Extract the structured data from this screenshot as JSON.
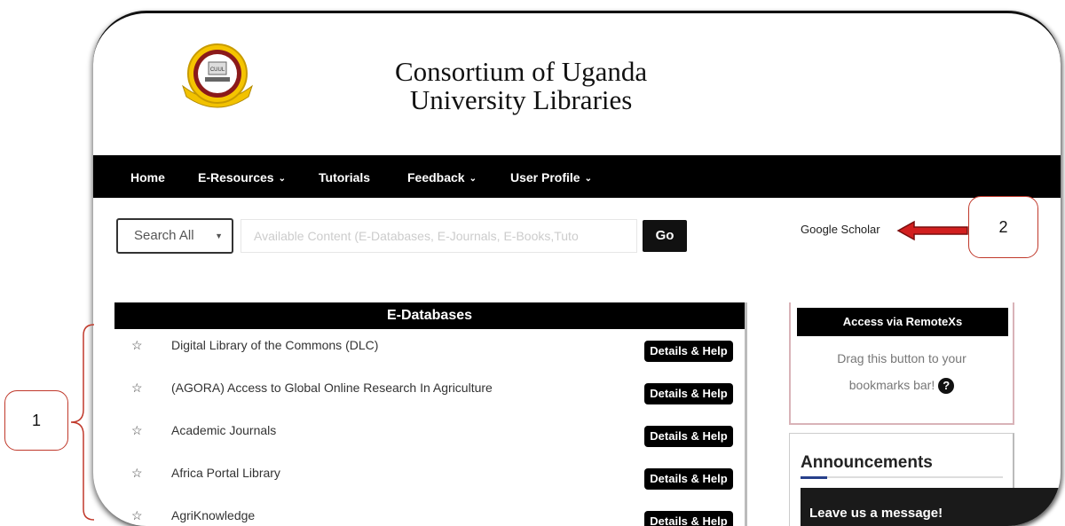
{
  "site": {
    "title_line1": "Consortium of Uganda",
    "title_line2": "University Libraries"
  },
  "nav": {
    "items": [
      {
        "label": "Home",
        "dropdown": false
      },
      {
        "label": "E-Resources",
        "dropdown": true
      },
      {
        "label": "Tutorials",
        "dropdown": false
      },
      {
        "label": "Feedback",
        "dropdown": true
      },
      {
        "label": "User Profile",
        "dropdown": true
      }
    ]
  },
  "search": {
    "scope_value": "Search All",
    "placeholder": "Available Content (E-Databases, E-Journals, E-Books,Tuto",
    "go_label": "Go"
  },
  "links": {
    "google_scholar": "Google Scholar"
  },
  "edatabases": {
    "title": "E-Databases",
    "details_label": "Details & Help",
    "items": [
      "Digital Library of the Commons (DLC)",
      "(AGORA) Access to Global Online Research In Agriculture",
      "Academic Journals",
      "Africa Portal Library",
      "AgriKnowledge"
    ]
  },
  "remotexs": {
    "title": "Access via RemoteXs",
    "line1": "Drag this button to your",
    "line2": "bookmarks bar!",
    "help_icon": "?"
  },
  "announcements": {
    "title": "Announcements"
  },
  "chat": {
    "label": "Leave us a message!"
  },
  "annotations": {
    "callout1": "1",
    "callout2": "2",
    "color": "#c0392b"
  }
}
